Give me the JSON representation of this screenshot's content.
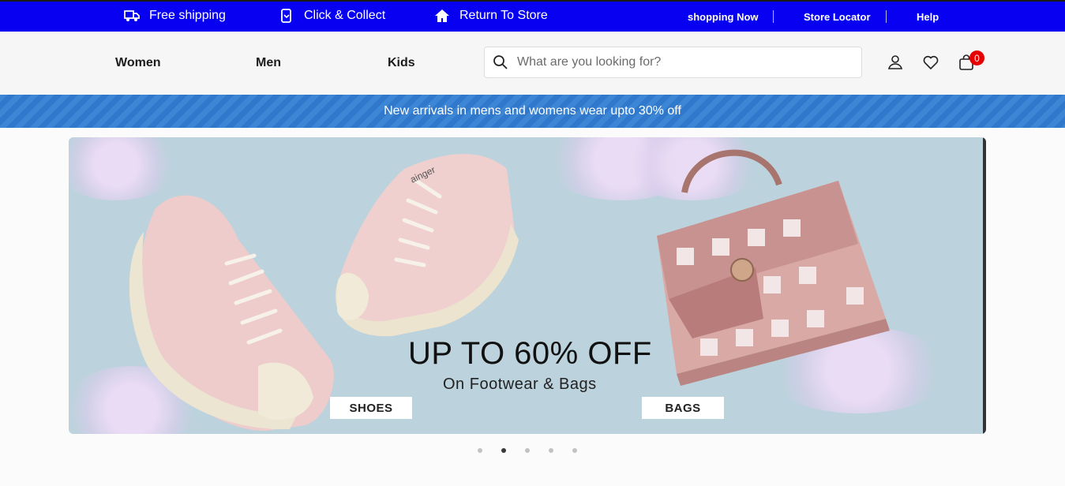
{
  "topbar": {
    "free_shipping": "Free shipping",
    "click_collect": "Click & Collect",
    "return_store": "Return To Store",
    "shopping_now": "shopping Now",
    "store_locator": "Store Locator",
    "help": "Help",
    "bg_color": "#0800f0"
  },
  "nav": {
    "women": "Women",
    "men": "Men",
    "kids": "Kids"
  },
  "search": {
    "placeholder": "What are you looking for?"
  },
  "header_icons": [
    "user-icon",
    "heart-icon",
    "shopping-bag-icon"
  ],
  "cart": {
    "count": "0",
    "badge_color": "#e60000"
  },
  "promo": {
    "text": "New arrivals in mens and womens wear upto 30% off"
  },
  "banner": {
    "headline": "UP TO 60% OFF",
    "subline": "On Footwear & Bags",
    "shoes_label": "SHOES",
    "bags_label": "BAGS",
    "shoe_brand_text": "ainger"
  },
  "carousel": {
    "total_slides": 5,
    "active_index": 1
  }
}
